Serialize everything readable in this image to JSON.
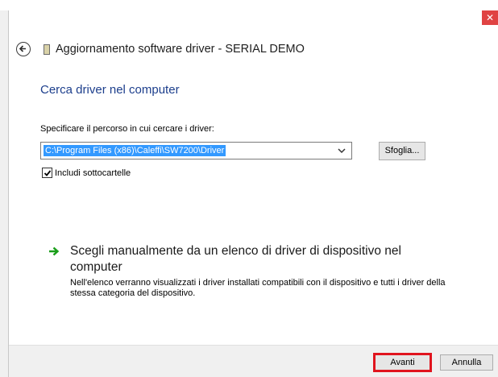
{
  "window": {
    "title": "Aggiornamento software driver - SERIAL DEMO",
    "close_glyph": "✕"
  },
  "section": {
    "title": "Cerca driver nel computer"
  },
  "path": {
    "label": "Specificare il percorso in cui cercare i driver:",
    "value": "C:\\Program Files (x86)\\Caleffi\\SW7200\\Driver",
    "browse_label": "Sfoglia..."
  },
  "subfolders": {
    "label": "Includi sottocartelle",
    "checked": true
  },
  "manual_option": {
    "title": "Scegli manualmente da un elenco di driver di dispositivo nel computer",
    "description": "Nell'elenco verranno visualizzati i driver installati compatibili con il dispositivo e tutti i driver della stessa categoria del dispositivo."
  },
  "footer": {
    "next_label": "Avanti",
    "cancel_label": "Annulla"
  },
  "colors": {
    "accent_title": "#1c3e8c",
    "selection": "#3399ff",
    "highlight_border": "#e0141e",
    "arrow_green": "#1a9e1a"
  }
}
